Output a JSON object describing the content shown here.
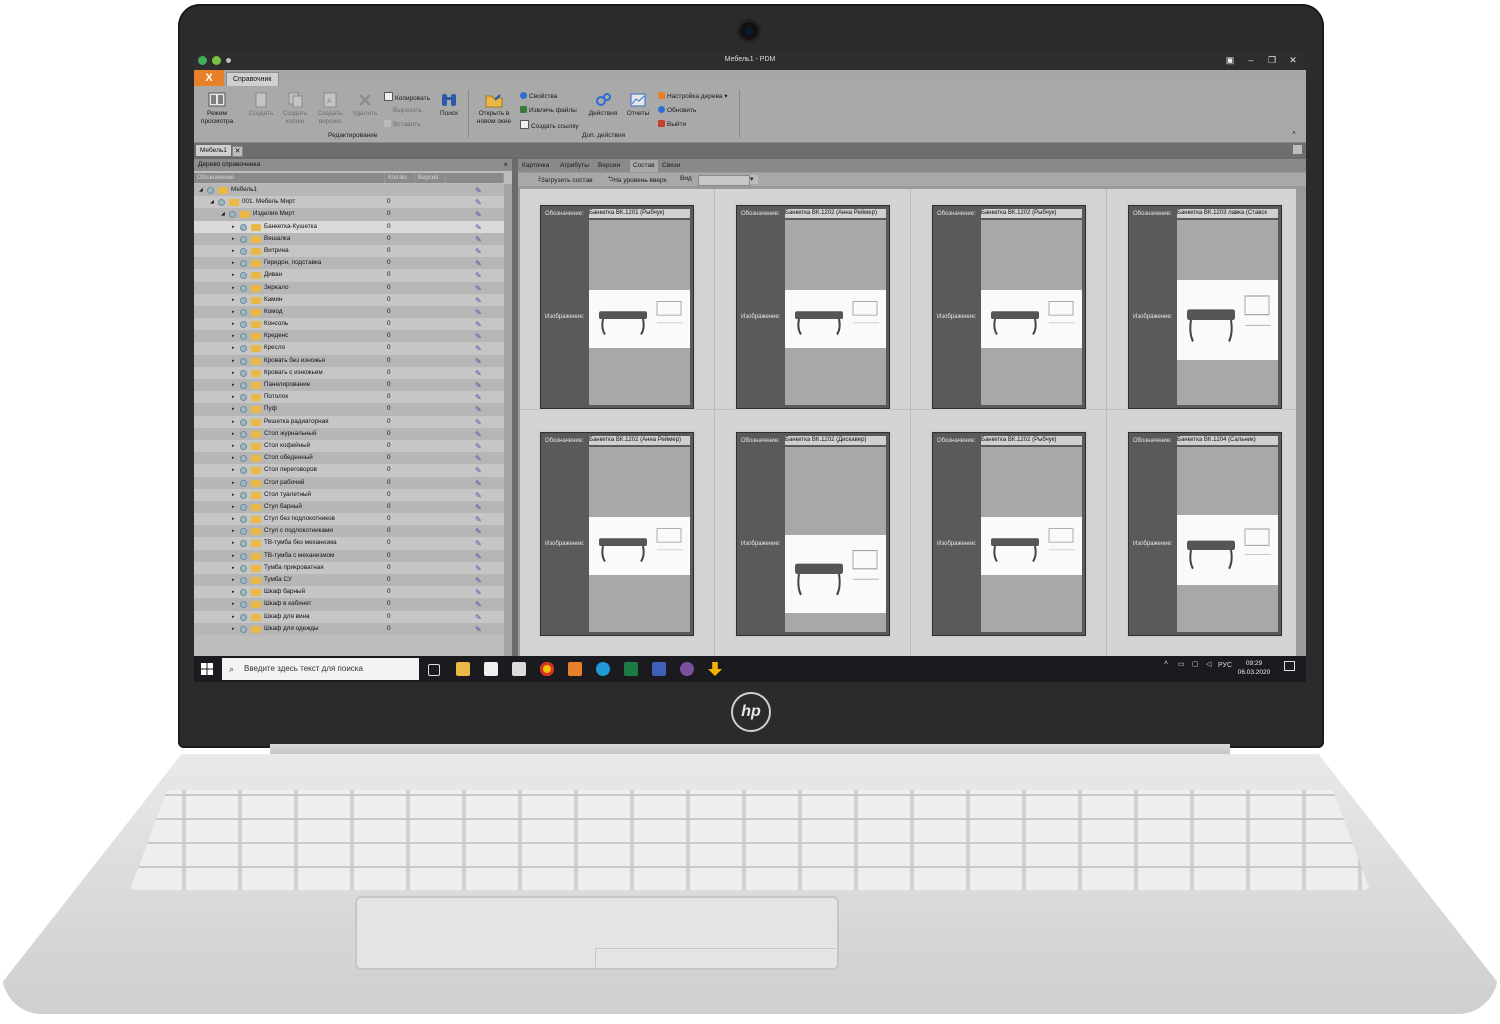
{
  "window": {
    "title": "Мебель1 - PDM"
  },
  "ribbon": {
    "app_button": "X",
    "tab": "Справочник",
    "buttons": {
      "view_mode": "Режим просмотра",
      "create": "Создать",
      "create_copy": "Создать копию",
      "create_version": "Создать версию",
      "delete": "Удалить",
      "copy": "Копировать",
      "cut": "Вырезать",
      "paste": "Вставить",
      "search": "Поиск",
      "open_new_window": "Открыть в новом окне",
      "properties": "Свойства",
      "extract_files": "Извлечь файлы",
      "create_link": "Создать ссылку",
      "actions": "Действия",
      "reports": "Отчеты",
      "tree_settings": "Настройка дерева",
      "refresh": "Обновить",
      "exit": "Выйти"
    },
    "groups": {
      "editing": "Редактирование",
      "extra_actions": "Доп. действия"
    }
  },
  "doc_tab": {
    "label": "Мебель1",
    "close": "✕"
  },
  "tree": {
    "title": "Дерево справочника",
    "close": "×",
    "columns": {
      "designation": "Обозначение",
      "count": "Кол-во",
      "version": "Версия"
    },
    "rows": [
      {
        "label": "Мебель1",
        "count": "",
        "level": 0
      },
      {
        "label": "001. Мебель Мирт",
        "count": "0",
        "level": 1
      },
      {
        "label": "Изделия Мирт",
        "count": "0",
        "level": 2
      },
      {
        "label": "Банкетка-Кушетка",
        "count": "0",
        "level": 3,
        "selected": true
      },
      {
        "label": "Вешалка",
        "count": "0",
        "level": 3
      },
      {
        "label": "Витрина",
        "count": "0",
        "level": 3
      },
      {
        "label": "Геридон, подставка",
        "count": "0",
        "level": 3
      },
      {
        "label": "Диван",
        "count": "0",
        "level": 3
      },
      {
        "label": "Зеркало",
        "count": "0",
        "level": 3
      },
      {
        "label": "Камин",
        "count": "0",
        "level": 3
      },
      {
        "label": "Комод",
        "count": "0",
        "level": 3
      },
      {
        "label": "Консоль",
        "count": "0",
        "level": 3
      },
      {
        "label": "Креденс",
        "count": "0",
        "level": 3
      },
      {
        "label": "Кресло",
        "count": "0",
        "level": 3
      },
      {
        "label": "Кровать без изножья",
        "count": "0",
        "level": 3
      },
      {
        "label": "Кровать с изножьем",
        "count": "0",
        "level": 3
      },
      {
        "label": "Панелирование",
        "count": "0",
        "level": 3
      },
      {
        "label": "Потолок",
        "count": "0",
        "level": 3
      },
      {
        "label": "Пуф",
        "count": "0",
        "level": 3
      },
      {
        "label": "Решетка радиаторная",
        "count": "0",
        "level": 3
      },
      {
        "label": "Стол журнальный",
        "count": "0",
        "level": 3
      },
      {
        "label": "Стол кофейный",
        "count": "0",
        "level": 3
      },
      {
        "label": "Стол обеденный",
        "count": "0",
        "level": 3
      },
      {
        "label": "Стол переговоров",
        "count": "0",
        "level": 3
      },
      {
        "label": "Стол рабочий",
        "count": "0",
        "level": 3
      },
      {
        "label": "Стол туалетный",
        "count": "0",
        "level": 3
      },
      {
        "label": "Стул барный",
        "count": "0",
        "level": 3
      },
      {
        "label": "Стул без подлокотников",
        "count": "0",
        "level": 3
      },
      {
        "label": "Стул с подлокотниками",
        "count": "0",
        "level": 3
      },
      {
        "label": "ТВ-тумба без механизма",
        "count": "0",
        "level": 3
      },
      {
        "label": "ТВ-тумба с механизмом",
        "count": "0",
        "level": 3
      },
      {
        "label": "Тумба прикроватная",
        "count": "0",
        "level": 3
      },
      {
        "label": "Тумба СУ",
        "count": "0",
        "level": 3
      },
      {
        "label": "Шкаф барный",
        "count": "0",
        "level": 3
      },
      {
        "label": "Шкаф в кабинет",
        "count": "0",
        "level": 3
      },
      {
        "label": "Шкаф для вина",
        "count": "0",
        "level": 3
      },
      {
        "label": "Шкаф для одежды",
        "count": "0",
        "level": 3
      }
    ]
  },
  "right": {
    "tabs": [
      "Карточка",
      "Атрибуты",
      "Версии",
      "Состав",
      "Связи"
    ],
    "active_tab": "Состав",
    "toolbar": {
      "load": "Загрузить состав",
      "up": "На уровень вверх",
      "view": "Вид"
    },
    "card_labels": {
      "designation": "Обозначение:",
      "image": "Изображение:"
    },
    "cards": [
      {
        "designation": "Банкетка ВК.1201 (Рыбчук)"
      },
      {
        "designation": "Банкетка ВК.1202 (Анна Реймер)"
      },
      {
        "designation": "Банкетка ВК.1202 (Рыбчук)"
      },
      {
        "designation": "Банкетка ВК.1203 лавка (Ставск"
      },
      {
        "designation": "Банкетка ВК.1202 (Анна Реймер)"
      },
      {
        "designation": "Банкетка ВК.1202 (Дискавер)"
      },
      {
        "designation": "Банкетка ВК.1202 (Рыбчук)"
      },
      {
        "designation": "Банкетка ВК.1204 (Сальник)"
      }
    ]
  },
  "taskbar": {
    "search_placeholder": "Введите здесь текст для поиска",
    "lang": "РУС",
    "time": "09:29",
    "date": "06.03.2020"
  },
  "laptop": {
    "brand": "hp"
  },
  "colors": {
    "accent": "#e8802a",
    "ribbon": "#a9a9a9",
    "taskbar": "#1b1b1f"
  }
}
